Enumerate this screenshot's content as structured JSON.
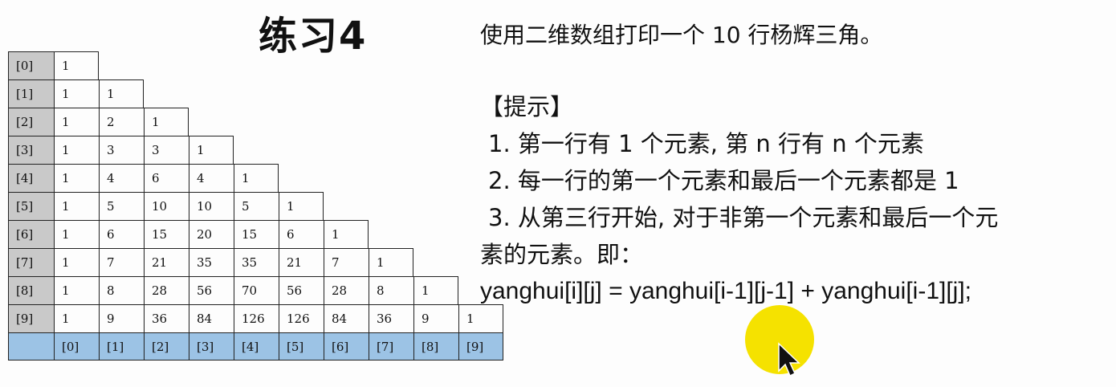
{
  "title": "练习4",
  "task": "使用二维数组打印一个 10 行杨辉三角。",
  "hints": {
    "header": "【提示】",
    "items": [
      "1. 第一行有 1 个元素, 第 n 行有 n 个元素",
      "2. 每一行的第一个元素和最后一个元素都是 1",
      "3. 从第三行开始, 对于非第一个元素和最后一个元"
    ],
    "continuation": "素的元素。即：",
    "formula": "yanghui[i][j] = yanghui[i-1][j-1] + yanghui[i-1][j];"
  },
  "triangle": {
    "row_labels": [
      "[0]",
      "[1]",
      "[2]",
      "[3]",
      "[4]",
      "[5]",
      "[6]",
      "[7]",
      "[8]",
      "[9]"
    ],
    "col_labels": [
      "[0]",
      "[1]",
      "[2]",
      "[3]",
      "[4]",
      "[5]",
      "[6]",
      "[7]",
      "[8]",
      "[9]"
    ],
    "rows": [
      [
        "1"
      ],
      [
        "1",
        "1"
      ],
      [
        "1",
        "2",
        "1"
      ],
      [
        "1",
        "3",
        "3",
        "1"
      ],
      [
        "1",
        "4",
        "6",
        "4",
        "1"
      ],
      [
        "1",
        "5",
        "10",
        "10",
        "5",
        "1"
      ],
      [
        "1",
        "6",
        "15",
        "20",
        "15",
        "6",
        "1"
      ],
      [
        "1",
        "7",
        "21",
        "35",
        "35",
        "21",
        "7",
        "1"
      ],
      [
        "1",
        "8",
        "28",
        "56",
        "70",
        "56",
        "28",
        "8",
        "1"
      ],
      [
        "1",
        "9",
        "36",
        "84",
        "126",
        "126",
        "84",
        "36",
        "9",
        "1"
      ]
    ]
  },
  "colors": {
    "row_header_bg": "#c9c9c9",
    "col_header_bg": "#9cc3e5",
    "cursor_highlight": "#f5e200"
  },
  "cursor": {
    "icon": "mouse-pointer-icon"
  }
}
